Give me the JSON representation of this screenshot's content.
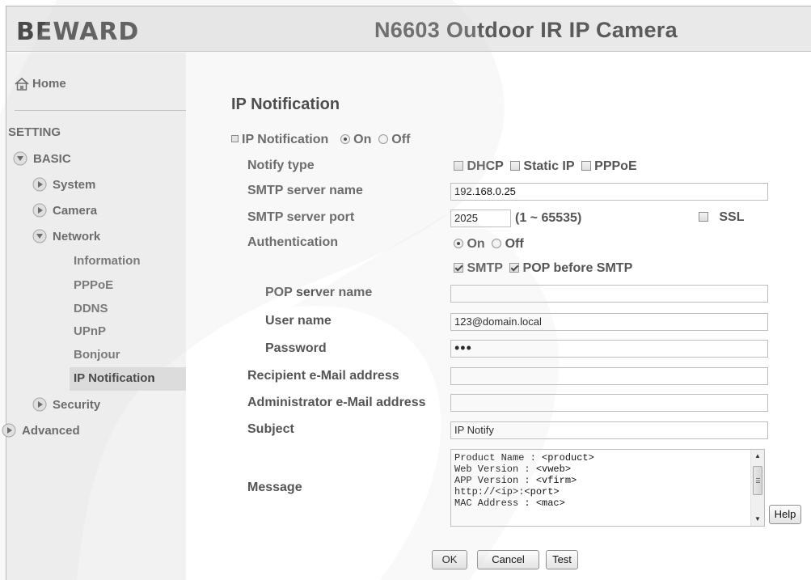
{
  "header": {
    "logo": {
      "text": "BEWARD"
    },
    "product_title": "N6603 Outdoor IR IP Camera"
  },
  "sidebar": {
    "home_label": "Home",
    "setting_label": "SETTING",
    "basic_label": "BASIC",
    "system_label": "System",
    "camera_label": "Camera",
    "network_label": "Network",
    "network_items": [
      "Information",
      "PPPoE",
      "DDNS",
      "UPnP",
      "Bonjour",
      "IP Notification"
    ],
    "active_item": "IP Notification",
    "security_label": "Security",
    "advanced_label": "Advanced"
  },
  "main": {
    "title": "IP Notification",
    "ip_notification": {
      "label": "IP Notification",
      "on_label": "On",
      "off_label": "Off",
      "selected": "On"
    },
    "notify_type": {
      "label": "Notify type",
      "options": [
        "DHCP",
        "Static IP",
        "PPPoE"
      ],
      "checked": [
        false,
        false,
        false
      ]
    },
    "smtp_server_name": {
      "label": "SMTP server name",
      "value": "192.168.0.25"
    },
    "smtp_server_port": {
      "label": "SMTP server port",
      "value": "2025",
      "range": "(1 ~ 65535)",
      "ssl_label": "SSL",
      "ssl_checked": false
    },
    "authentication": {
      "label": "Authentication",
      "on_label": "On",
      "off_label": "Off",
      "selected": "On",
      "smtp_label": "SMTP",
      "smtp_checked": true,
      "pop_label": "POP before SMTP",
      "pop_checked": true
    },
    "pop_server_name": {
      "label": "POP server name",
      "value": ""
    },
    "user_name": {
      "label": "User name",
      "value": "123@domain.local"
    },
    "password": {
      "label": "Password",
      "value": "•••"
    },
    "recipient_email": {
      "label": "Recipient e-Mail address",
      "value": ""
    },
    "admin_email": {
      "label": "Administrator e-Mail address",
      "value": ""
    },
    "subject": {
      "label": "Subject",
      "value": "IP Notify"
    },
    "message": {
      "label": "Message",
      "lines": [
        "Product Name : <product>",
        "Web Version : <vweb>",
        "APP Version : <vfirm>",
        "http://<ip>:<port>",
        "MAC Address : <mac>"
      ]
    },
    "buttons": {
      "help": "Help",
      "ok": "OK",
      "cancel": "Cancel",
      "test": "Test"
    }
  },
  "colors": {
    "header_bg": "#e9e9e9",
    "sidebar_bg": "#f2f2f2",
    "active_bg": "#dcdcdc",
    "text": "#555555"
  }
}
